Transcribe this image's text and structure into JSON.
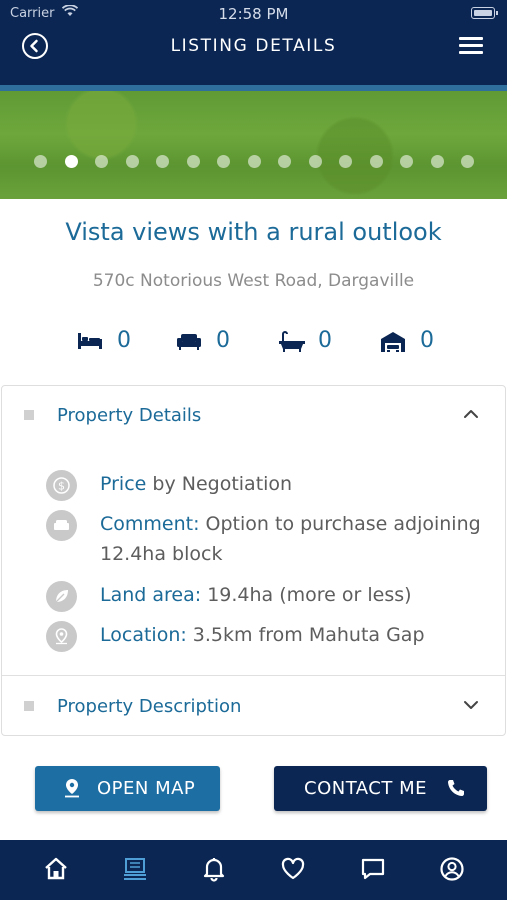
{
  "status_bar": {
    "carrier": "Carrier",
    "time": "12:58 PM"
  },
  "header": {
    "title": "LISTING DETAILS"
  },
  "gallery": {
    "total_images": 15,
    "active_index": 1
  },
  "listing": {
    "title": "Vista views with a rural outlook",
    "address": "570c Notorious West Road, Dargaville",
    "features": [
      {
        "icon": "bed-icon",
        "count": "0"
      },
      {
        "icon": "sofa-icon",
        "count": "0"
      },
      {
        "icon": "bathtub-icon",
        "count": "0"
      },
      {
        "icon": "garage-icon",
        "count": "0"
      }
    ]
  },
  "property_details": {
    "title": "Property Details",
    "expanded": true,
    "rows": [
      {
        "icon": "dollar-icon",
        "label": "Price",
        "value": " by Negotiation"
      },
      {
        "icon": "sofa-icon",
        "label": "Comment:",
        "value": " Option to purchase adjoining 12.4ha block"
      },
      {
        "icon": "leaf-icon",
        "label": "Land area:",
        "value": " 19.4ha (more or less)"
      },
      {
        "icon": "location-pin-icon",
        "label": "Location:",
        "value": " 3.5km from Mahuta Gap"
      }
    ]
  },
  "property_description": {
    "title": "Property Description",
    "expanded": false
  },
  "actions": {
    "open_map": "OPEN MAP",
    "contact_me": "CONTACT ME"
  },
  "tabbar": {
    "active": "listings",
    "tabs": [
      "home-icon",
      "listings-icon",
      "bell-icon",
      "heart-icon",
      "chat-icon",
      "profile-icon"
    ]
  },
  "colors": {
    "navy": "#0b2652",
    "accent_blue": "#1b6a98",
    "button_blue": "#1d6ea3"
  }
}
